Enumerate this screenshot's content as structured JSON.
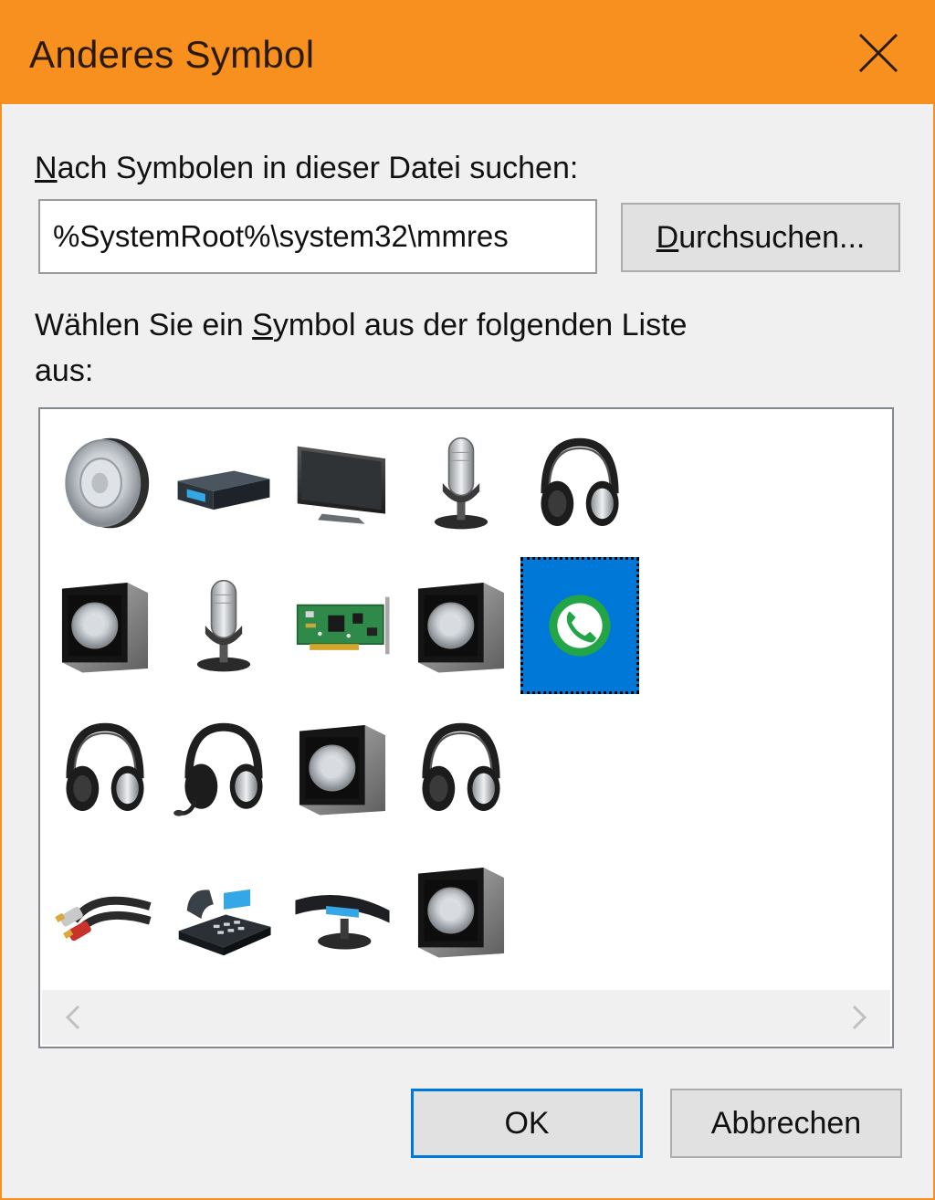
{
  "window": {
    "title": "Anderes Symbol",
    "accent_color": "#f7901e",
    "close_icon": "close-icon"
  },
  "search": {
    "label_prefix": "",
    "label_mnemonic": "N",
    "label_rest": "ach Symbolen in dieser Datei suchen:",
    "path_value": "%SystemRoot%\\system32\\mmres",
    "browse_mnemonic": "D",
    "browse_rest": "urchsuchen..."
  },
  "list": {
    "label_line1_a": "Wählen Sie ein ",
    "label_line1_mnemonic": "S",
    "label_line1_b": "ymbol aus der folgenden Liste",
    "label_line2": "aus:",
    "selected_index": 9,
    "selection_color": "#0078d7",
    "icons": [
      "speaker-icon",
      "receiver-box-icon",
      "monitor-icon",
      "microphone-icon",
      "headphones-icon",
      "speaker-box-icon",
      "microphone-icon",
      "sound-card-icon",
      "speaker-box-icon",
      "phone-call-icon",
      "headphones-icon",
      "headset-icon",
      "speaker-box-icon",
      "headphones-icon",
      "audio-cable-icon",
      "desk-phone-icon",
      "handset-base-icon",
      "speaker-box-icon"
    ]
  },
  "scrollbar": {
    "left_icon": "chevron-left-icon",
    "right_icon": "chevron-right-icon"
  },
  "buttons": {
    "ok": "OK",
    "cancel": "Abbrechen"
  }
}
